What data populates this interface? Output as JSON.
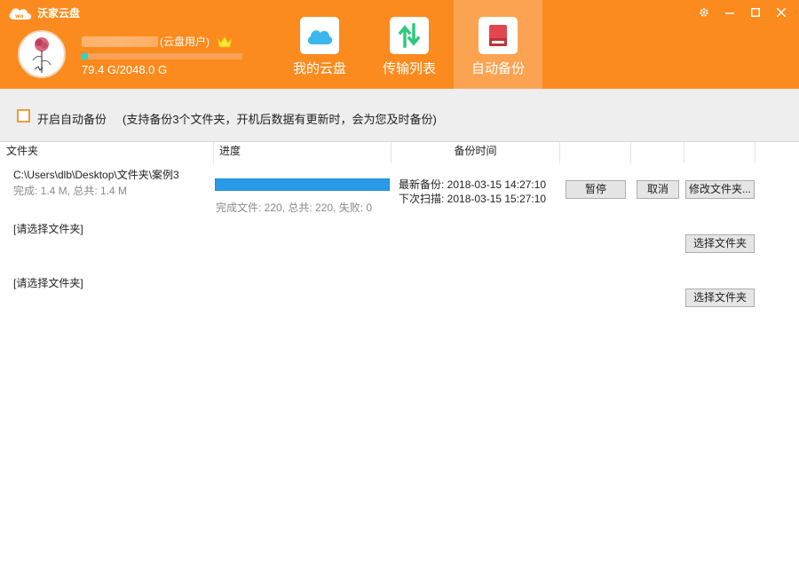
{
  "app": {
    "title": "沃家云盘",
    "window_controls": [
      "settings-icon",
      "minimize-icon",
      "maximize-icon",
      "close-icon"
    ]
  },
  "user": {
    "type_label": "(云盘用户)",
    "quota_text": "79.4 G/2048.0 G",
    "quota_fraction": 0.039
  },
  "nav": {
    "tabs": [
      {
        "label": "我的云盘",
        "icon": "cloud-icon",
        "active": false
      },
      {
        "label": "传输列表",
        "icon": "transfer-arrows-icon",
        "active": false
      },
      {
        "label": "自动备份",
        "icon": "backup-drive-icon",
        "active": true
      }
    ]
  },
  "options": {
    "enable_label": "开启自动备份",
    "enable_checked": false,
    "hint": "(支持备份3个文件夹，开机后数据有更新时，会为您及时备份)"
  },
  "table": {
    "headers": [
      "文件夹",
      "进度",
      "备份时间"
    ]
  },
  "rows": [
    {
      "path": "C:\\Users\\dlb\\Desktop\\文件夹\\案例3",
      "size_text": "完成: 1.4 M, 总共: 1.4 M",
      "progress_fraction": 1.0,
      "progress_text": "完成文件: 220, 总共: 220, 失败: 0",
      "last_backup": "最新备份: 2018-03-15 14:27:10",
      "next_scan": "下次扫描: 2018-03-15 15:27:10",
      "buttons": [
        "暂停",
        "取消",
        "修改文件夹..."
      ]
    },
    {
      "path": "[请选择文件夹]",
      "buttons": [
        "选择文件夹"
      ]
    },
    {
      "path": "[请选择文件夹]",
      "buttons": [
        "选择文件夹"
      ]
    }
  ]
}
